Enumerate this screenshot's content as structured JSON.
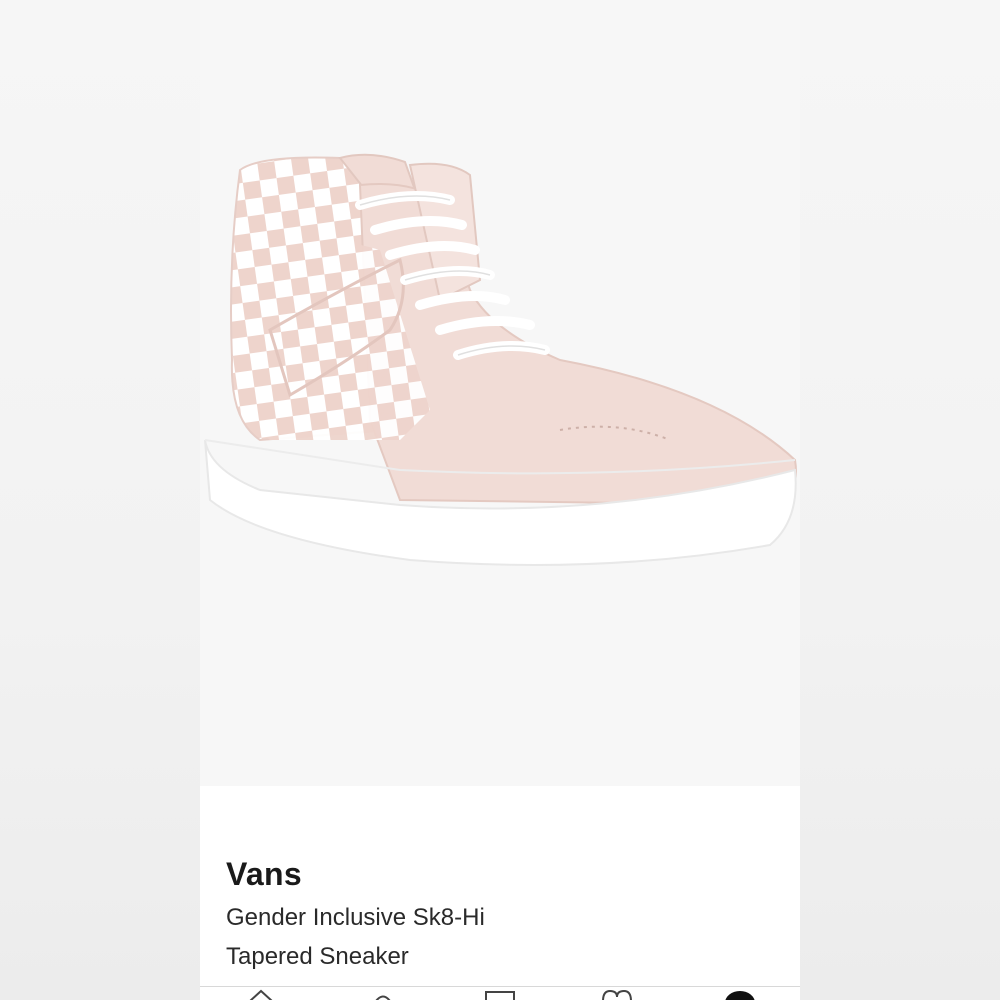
{
  "product": {
    "brand": "Vans",
    "name_line1": "Gender Inclusive Sk8-Hi",
    "name_line2": "Tapered Sneaker",
    "image_icon": "checkered-sneaker-image"
  },
  "bottom_nav": {
    "items": [
      "home-icon",
      "search-icon",
      "calendar-icon",
      "heart-icon",
      "account-icon"
    ]
  },
  "colors": {
    "pink": "#efd6cf",
    "suede": "#f1dcd6",
    "sole": "#ffffff",
    "text": "#1a1a1a"
  }
}
